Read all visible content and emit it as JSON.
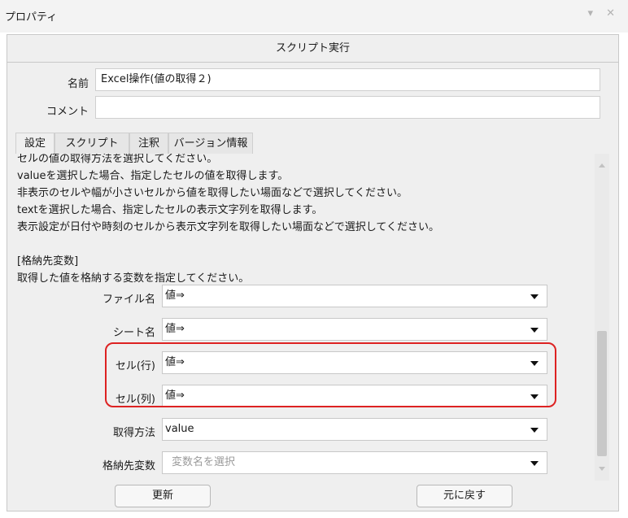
{
  "window": {
    "title": "プロパティ",
    "controls": "▾ ✕"
  },
  "header": {
    "title": "スクリプト実行"
  },
  "form": {
    "name_label": "名前",
    "name_value": "Excel操作(値の取得２)",
    "comment_label": "コメント",
    "comment_value": ""
  },
  "tabs": [
    {
      "label": "設定",
      "active": true
    },
    {
      "label": "スクリプト",
      "active": false
    },
    {
      "label": "注釈",
      "active": false
    },
    {
      "label": "バージョン情報",
      "active": false
    }
  ],
  "description": [
    "セルの値の取得方法を選択してください。",
    "valueを選択した場合、指定したセルの値を取得します。",
    "非表示のセルや幅が小さいセルから値を取得したい場面などで選択してください。",
    "textを選択した場合、指定したセルの表示文字列を取得します。",
    "表示設定が日付や時刻のセルから表示文字列を取得したい場面などで選択してください。",
    "",
    "[格納先変数]",
    "取得した値を格納する変数を指定してください。"
  ],
  "fields": [
    {
      "label": "ファイル名",
      "value": "値⇒"
    },
    {
      "label": "シート名",
      "value": "値⇒"
    },
    {
      "label": "セル(行)",
      "value": "値⇒"
    },
    {
      "label": "セル(列)",
      "value": "値⇒"
    },
    {
      "label": "取得方法",
      "value": "value"
    },
    {
      "label": "格納先変数",
      "placeholder": "変数名を選択"
    }
  ],
  "buttons": {
    "update": "更新",
    "revert": "元に戻す"
  },
  "colors": {
    "highlight": "#dd2222",
    "panel_bg": "#efefef"
  }
}
